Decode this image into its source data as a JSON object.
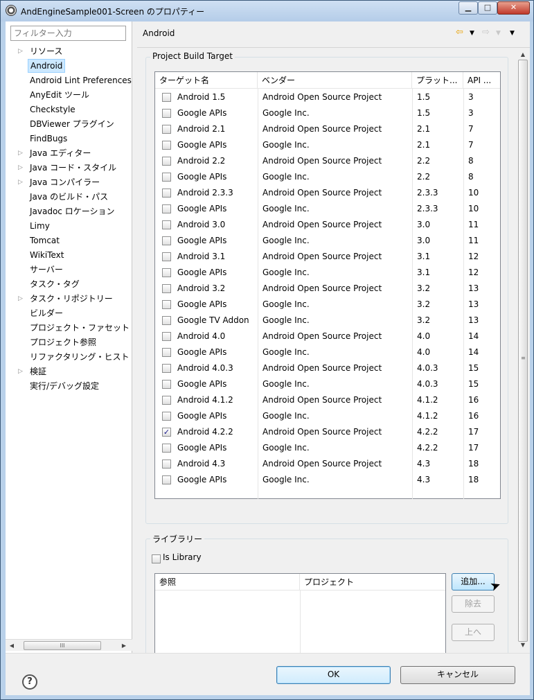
{
  "window": {
    "title": "AndEngineSample001-Screen のプロパティー",
    "min_glyph": "▁",
    "max_glyph": "□",
    "close_glyph": "✕"
  },
  "left": {
    "filter_placeholder": "フィルター入力",
    "tree": [
      {
        "label": "リソース",
        "expandable": true
      },
      {
        "label": "Android",
        "expandable": false,
        "selected": true
      },
      {
        "label": "Android Lint Preferences",
        "expandable": false
      },
      {
        "label": "AnyEdit ツール",
        "expandable": false
      },
      {
        "label": "Checkstyle",
        "expandable": false
      },
      {
        "label": "DBViewer プラグイン",
        "expandable": false
      },
      {
        "label": "FindBugs",
        "expandable": false
      },
      {
        "label": "Java エディター",
        "expandable": true
      },
      {
        "label": "Java コード・スタイル",
        "expandable": true
      },
      {
        "label": "Java コンパイラー",
        "expandable": true
      },
      {
        "label": "Java のビルド・パス",
        "expandable": false
      },
      {
        "label": "Javadoc ロケーション",
        "expandable": false
      },
      {
        "label": "Limy",
        "expandable": false
      },
      {
        "label": "Tomcat",
        "expandable": false
      },
      {
        "label": "WikiText",
        "expandable": false
      },
      {
        "label": "サーバー",
        "expandable": false
      },
      {
        "label": "タスク・タグ",
        "expandable": false
      },
      {
        "label": "タスク・リポジトリー",
        "expandable": true
      },
      {
        "label": "ビルダー",
        "expandable": false
      },
      {
        "label": "プロジェクト・ファセット",
        "expandable": false
      },
      {
        "label": "プロジェクト参照",
        "expandable": false
      },
      {
        "label": "リファクタリング・ヒスト",
        "expandable": false
      },
      {
        "label": "検証",
        "expandable": true
      },
      {
        "label": "実行/デバッグ設定",
        "expandable": false
      }
    ],
    "hscroll_grip": "III"
  },
  "page": {
    "title": "Android",
    "build_target": {
      "group_label": "Project Build Target",
      "columns": [
        "ターゲット名",
        "ベンダー",
        "プラット...",
        "API ..."
      ],
      "rows": [
        {
          "checked": false,
          "name": "Android 1.5",
          "vendor": "Android Open Source Project",
          "platform": "1.5",
          "api": "3"
        },
        {
          "checked": false,
          "name": "Google APIs",
          "vendor": "Google Inc.",
          "platform": "1.5",
          "api": "3"
        },
        {
          "checked": false,
          "name": "Android 2.1",
          "vendor": "Android Open Source Project",
          "platform": "2.1",
          "api": "7"
        },
        {
          "checked": false,
          "name": "Google APIs",
          "vendor": "Google Inc.",
          "platform": "2.1",
          "api": "7"
        },
        {
          "checked": false,
          "name": "Android 2.2",
          "vendor": "Android Open Source Project",
          "platform": "2.2",
          "api": "8"
        },
        {
          "checked": false,
          "name": "Google APIs",
          "vendor": "Google Inc.",
          "platform": "2.2",
          "api": "8"
        },
        {
          "checked": false,
          "name": "Android 2.3.3",
          "vendor": "Android Open Source Project",
          "platform": "2.3.3",
          "api": "10"
        },
        {
          "checked": false,
          "name": "Google APIs",
          "vendor": "Google Inc.",
          "platform": "2.3.3",
          "api": "10"
        },
        {
          "checked": false,
          "name": "Android 3.0",
          "vendor": "Android Open Source Project",
          "platform": "3.0",
          "api": "11"
        },
        {
          "checked": false,
          "name": "Google APIs",
          "vendor": "Google Inc.",
          "platform": "3.0",
          "api": "11"
        },
        {
          "checked": false,
          "name": "Android 3.1",
          "vendor": "Android Open Source Project",
          "platform": "3.1",
          "api": "12"
        },
        {
          "checked": false,
          "name": "Google APIs",
          "vendor": "Google Inc.",
          "platform": "3.1",
          "api": "12"
        },
        {
          "checked": false,
          "name": "Android 3.2",
          "vendor": "Android Open Source Project",
          "platform": "3.2",
          "api": "13"
        },
        {
          "checked": false,
          "name": "Google APIs",
          "vendor": "Google Inc.",
          "platform": "3.2",
          "api": "13"
        },
        {
          "checked": false,
          "name": "Google TV Addon",
          "vendor": "Google Inc.",
          "platform": "3.2",
          "api": "13"
        },
        {
          "checked": false,
          "name": "Android 4.0",
          "vendor": "Android Open Source Project",
          "platform": "4.0",
          "api": "14"
        },
        {
          "checked": false,
          "name": "Google APIs",
          "vendor": "Google Inc.",
          "platform": "4.0",
          "api": "14"
        },
        {
          "checked": false,
          "name": "Android 4.0.3",
          "vendor": "Android Open Source Project",
          "platform": "4.0.3",
          "api": "15"
        },
        {
          "checked": false,
          "name": "Google APIs",
          "vendor": "Google Inc.",
          "platform": "4.0.3",
          "api": "15"
        },
        {
          "checked": false,
          "name": "Android 4.1.2",
          "vendor": "Android Open Source Project",
          "platform": "4.1.2",
          "api": "16"
        },
        {
          "checked": false,
          "name": "Google APIs",
          "vendor": "Google Inc.",
          "platform": "4.1.2",
          "api": "16"
        },
        {
          "checked": true,
          "name": "Android 4.2.2",
          "vendor": "Android Open Source Project",
          "platform": "4.2.2",
          "api": "17"
        },
        {
          "checked": false,
          "name": "Google APIs",
          "vendor": "Google Inc.",
          "platform": "4.2.2",
          "api": "17"
        },
        {
          "checked": false,
          "name": "Android 4.3",
          "vendor": "Android Open Source Project",
          "platform": "4.3",
          "api": "18"
        },
        {
          "checked": false,
          "name": "Google APIs",
          "vendor": "Google Inc.",
          "platform": "4.3",
          "api": "18"
        }
      ]
    },
    "library": {
      "group_label": "ライブラリー",
      "is_library_label": "Is Library",
      "is_library_checked": false,
      "columns": [
        "参照",
        "プロジェクト"
      ],
      "add_button": "追加...",
      "remove_button": "除去",
      "up_button": "上へ"
    }
  },
  "footer": {
    "ok": "OK",
    "cancel": "キャンセル",
    "help_glyph": "?"
  },
  "colors": {
    "selection": "#cce8ff",
    "window_frame": "#b9d1ea",
    "back_arrow": "#e8a000"
  },
  "icons": [
    "app-icon",
    "back-arrow-icon",
    "forward-arrow-icon",
    "menu-down-icon",
    "help-icon",
    "checkmark-icon",
    "mouse-cursor-icon"
  ]
}
